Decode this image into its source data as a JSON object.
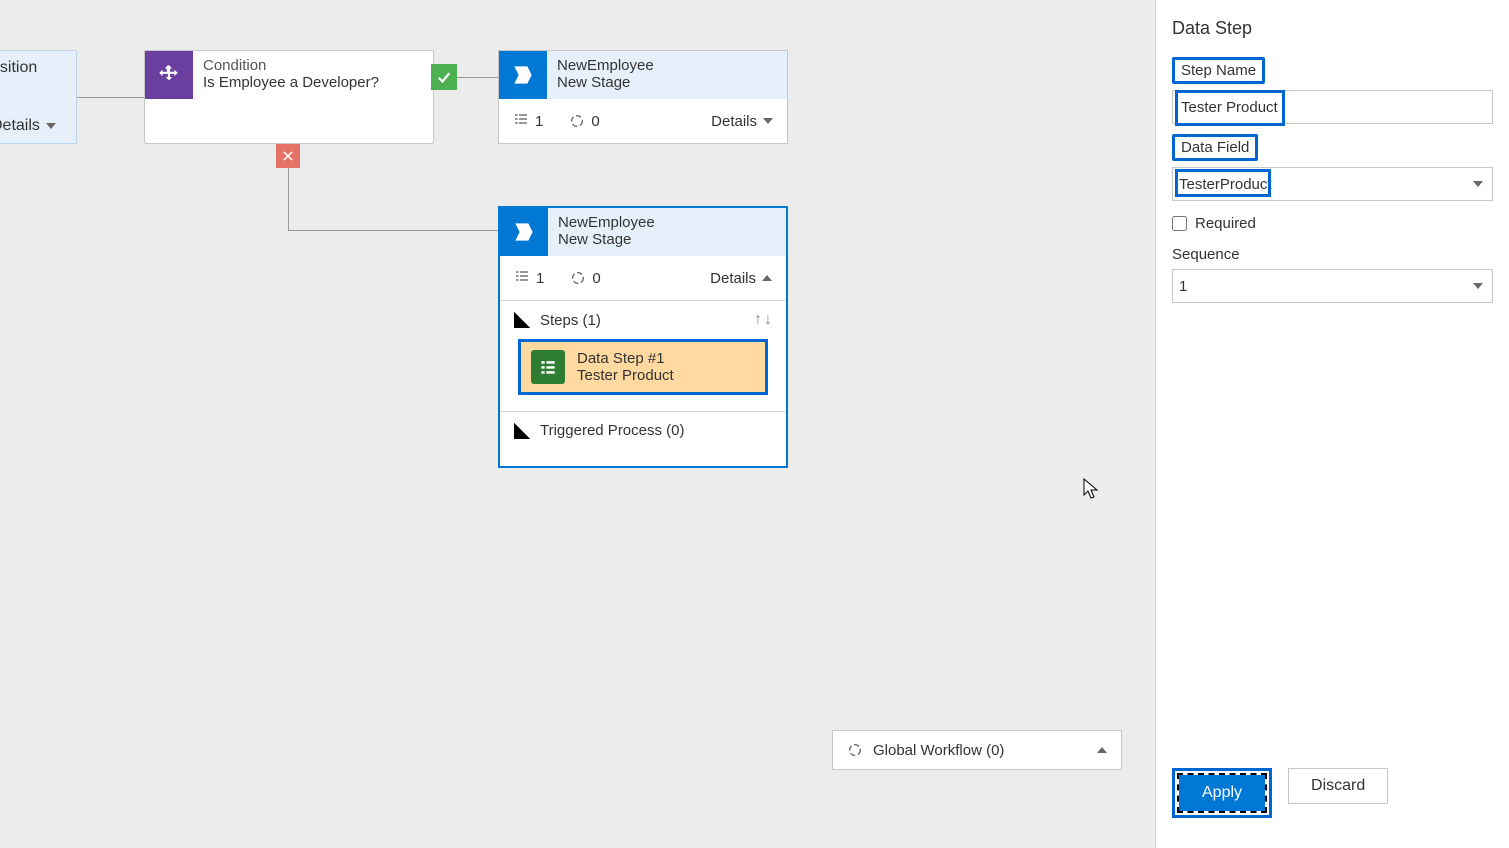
{
  "panel": {
    "title": "Data Step",
    "step_name_label": "Step Name",
    "step_name_value": "Tester Product",
    "data_field_label": "Data Field",
    "data_field_value": "TesterProduct",
    "required_label": "Required",
    "required_checked": false,
    "sequence_label": "Sequence",
    "sequence_value": "1",
    "apply_label": "Apply",
    "discard_label": "Discard"
  },
  "canvas": {
    "partial_node": {
      "line2": "osition",
      "details": "Details"
    },
    "condition": {
      "type_label": "Condition",
      "text": "Is Employee a Developer?"
    },
    "stage1": {
      "tlabel": "NewEmployee",
      "tline2": "New Stage",
      "count1": "1",
      "count2": "0",
      "details": "Details"
    },
    "stage2": {
      "tlabel": "NewEmployee",
      "tline2": "New Stage",
      "count1": "1",
      "count2": "0",
      "details": "Details",
      "steps_header": "Steps (1)",
      "data_step_title": "Data Step #1",
      "data_step_sub": "Tester Product",
      "triggered_header": "Triggered Process (0)"
    },
    "global_workflow": "Global Workflow (0)"
  }
}
